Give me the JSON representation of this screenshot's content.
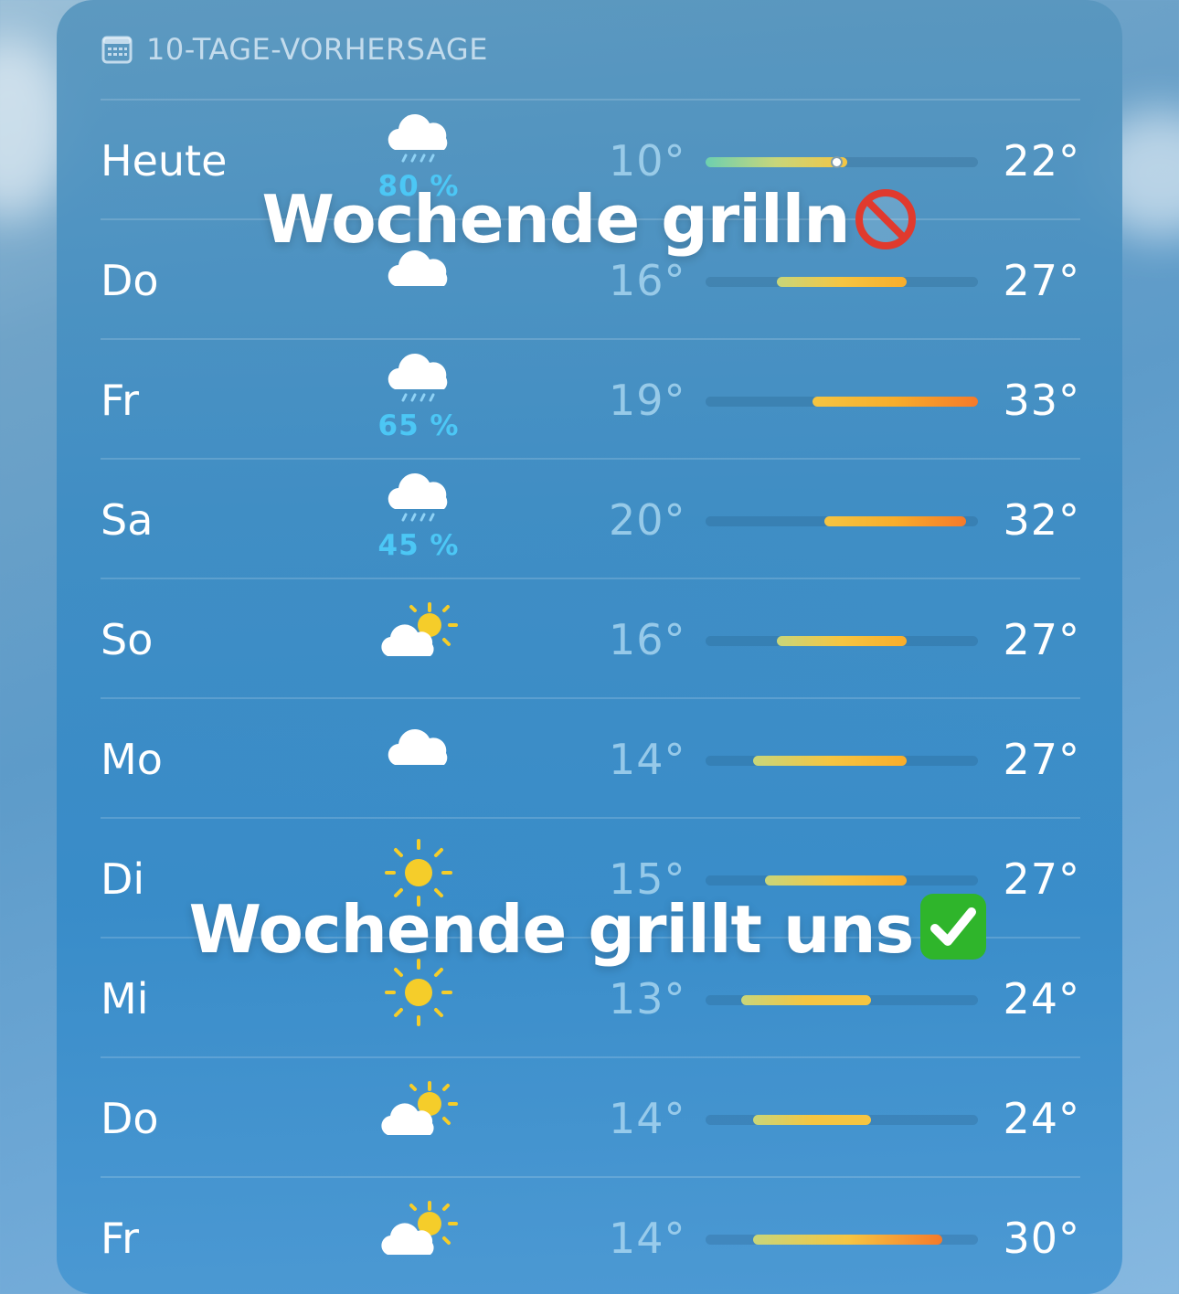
{
  "header": {
    "title": "10-TAGE-VORHERSAGE",
    "icon": "calendar-icon"
  },
  "days": [
    {
      "day": "Heute",
      "icon": "cloud-rain-icon",
      "precip": "80 %",
      "low": "10°",
      "high": "22°",
      "range": [
        10,
        22
      ],
      "current": 21
    },
    {
      "day": "Do",
      "icon": "cloud-icon",
      "precip": "",
      "low": "16°",
      "high": "27°",
      "range": [
        16,
        27
      ]
    },
    {
      "day": "Fr",
      "icon": "cloud-rain-icon",
      "precip": "65 %",
      "low": "19°",
      "high": "33°",
      "range": [
        19,
        33
      ]
    },
    {
      "day": "Sa",
      "icon": "cloud-rain-icon",
      "precip": "45 %",
      "low": "20°",
      "high": "32°",
      "range": [
        20,
        32
      ]
    },
    {
      "day": "So",
      "icon": "cloud-sun-icon",
      "precip": "",
      "low": "16°",
      "high": "27°",
      "range": [
        16,
        27
      ]
    },
    {
      "day": "Mo",
      "icon": "cloud-icon",
      "precip": "",
      "low": "14°",
      "high": "27°",
      "range": [
        14,
        27
      ]
    },
    {
      "day": "Di",
      "icon": "sun-icon",
      "precip": "",
      "low": "15°",
      "high": "27°",
      "range": [
        15,
        27
      ]
    },
    {
      "day": "Mi",
      "icon": "sun-icon",
      "precip": "",
      "low": "13°",
      "high": "24°",
      "range": [
        13,
        24
      ]
    },
    {
      "day": "Do",
      "icon": "cloud-sun-icon",
      "precip": "",
      "low": "14°",
      "high": "24°",
      "range": [
        14,
        24
      ]
    },
    {
      "day": "Fr",
      "icon": "cloud-sun-icon",
      "precip": "",
      "low": "14°",
      "high": "30°",
      "range": [
        14,
        30
      ]
    }
  ],
  "scale": {
    "min": 10,
    "max": 33
  },
  "overlays": {
    "top": "Wochende grilln",
    "top_emoji": "prohibited-icon",
    "bottom": "Wochende grillt uns",
    "bottom_emoji": "check-mark-icon"
  }
}
